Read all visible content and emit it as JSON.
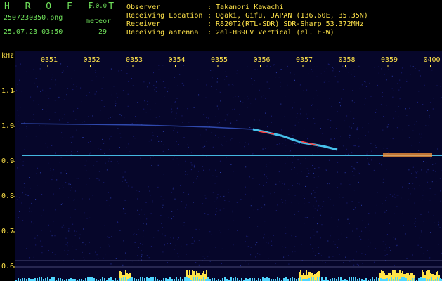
{
  "app": {
    "name": "H R O F F T",
    "version": "1.0.0"
  },
  "file": {
    "filename": "2507230350.png",
    "datetime": "25.07.23 03:50"
  },
  "meteor": {
    "label": "meteor",
    "count": "29"
  },
  "station": {
    "observer_label": "Observer",
    "observer_value": ": Takanori Kawachi",
    "location_label": "Receiving Location",
    "location_value": ": Ogaki, Gifu, JAPAN (136.60E, 35.35N)",
    "receiver_label": "Receiver",
    "receiver_value": ": R820T2(RTL-SDR) SDR-Sharp 53.372MHz",
    "antenna_label": "Receiving antenna",
    "antenna_value": ": 2el-HB9CV Vertical (el. E-W)"
  },
  "spectrogram": {
    "y_unit": "kHz",
    "x_ticks": [
      "0351",
      "0352",
      "0353",
      "0354",
      "0355",
      "0356",
      "0357",
      "0358",
      "0359",
      "0400"
    ],
    "y_ticks": [
      "1.1",
      "1.0",
      "0.9",
      "0.8",
      "0.7",
      "0.6"
    ],
    "colors": {
      "background": "#06062a",
      "label": "#ffe34a",
      "carrier": "#4fd6ff",
      "hot": "#ff4040",
      "grid": "#2a2a6a"
    }
  }
}
